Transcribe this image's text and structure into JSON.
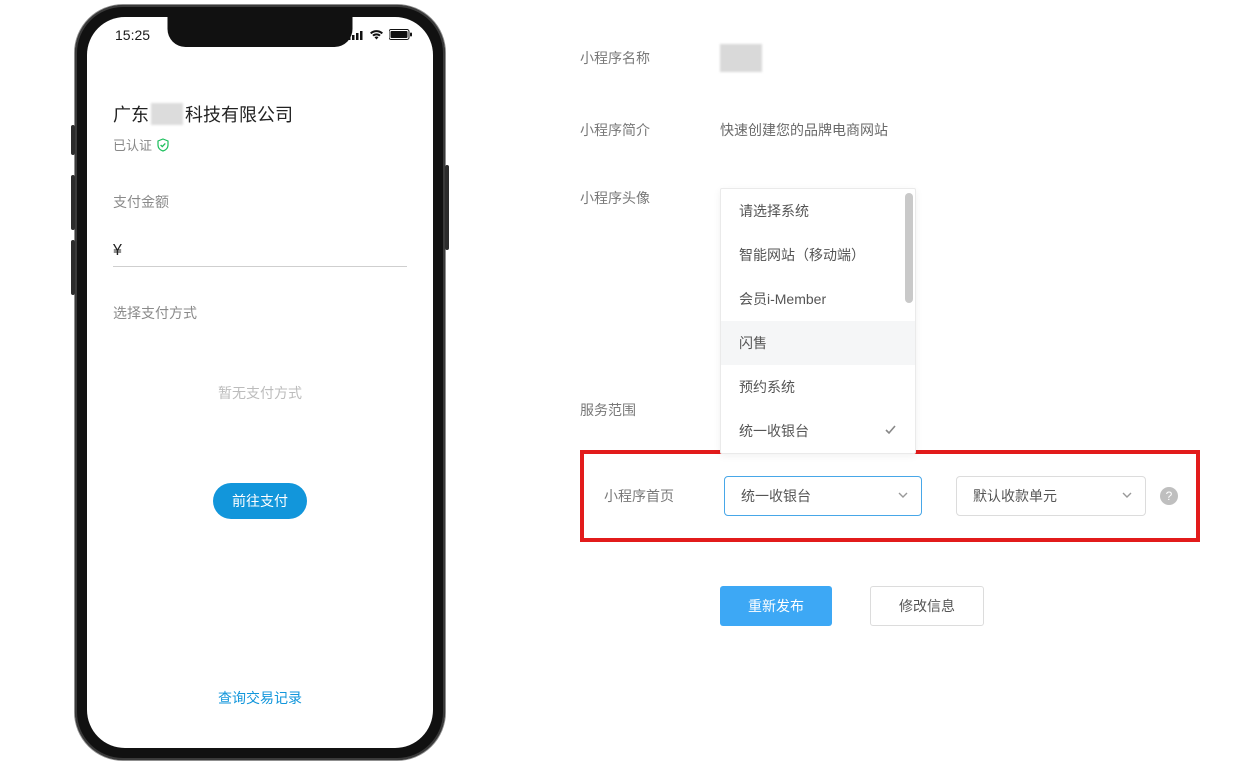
{
  "phone": {
    "status_time": "15:25",
    "company_prefix": "广东",
    "company_suffix": "科技有限公司",
    "verified_label": "已认证",
    "amount_label": "支付金额",
    "currency_symbol": "¥",
    "pay_method_label": "选择支付方式",
    "no_method_text": "暂无支付方式",
    "go_pay_label": "前往支付",
    "query_link_label": "查询交易记录"
  },
  "form": {
    "name_label": "小程序名称",
    "intro_label": "小程序简介",
    "intro_value": "快速创建您的品牌电商网站",
    "avatar_label": "小程序头像",
    "service_label": "服务范围",
    "homepage_label": "小程序首页",
    "dropdown": {
      "items": [
        "请选择系统",
        "智能网站（移动端）",
        "会员i-Member",
        "闪售",
        "预约系统",
        "统一收银台"
      ],
      "hover_index": 3,
      "checked_index": 5
    },
    "select1_value": "统一收银台",
    "select2_value": "默认收款单元",
    "help_glyph": "?",
    "publish_label": "重新发布",
    "modify_label": "修改信息"
  },
  "colors": {
    "primary_blue": "#3da8f5",
    "phone_blue": "#1296db",
    "highlight_red": "#e21b1b",
    "verified_green": "#1bbf5c"
  }
}
